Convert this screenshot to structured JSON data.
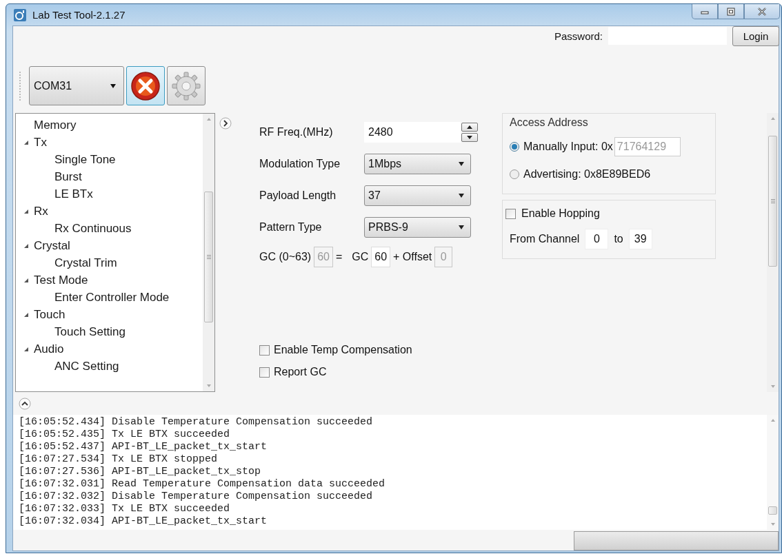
{
  "window": {
    "title": "Lab Test Tool-2.1.27"
  },
  "header": {
    "password_label": "Password:",
    "login_button": "Login"
  },
  "toolbar": {
    "port": "COM31"
  },
  "tree": {
    "items": [
      {
        "label": "Memory",
        "expanded": false
      },
      {
        "label": "Tx",
        "expanded": true,
        "children": [
          {
            "label": "Single Tone"
          },
          {
            "label": "Burst"
          },
          {
            "label": "LE BTx"
          }
        ]
      },
      {
        "label": "Rx",
        "expanded": true,
        "children": [
          {
            "label": "Rx Continuous"
          }
        ]
      },
      {
        "label": "Crystal",
        "expanded": true,
        "children": [
          {
            "label": "Crystal Trim"
          }
        ]
      },
      {
        "label": "Test Mode",
        "expanded": true,
        "children": [
          {
            "label": "Enter Controller Mode"
          }
        ]
      },
      {
        "label": "Touch",
        "expanded": true,
        "children": [
          {
            "label": "Touch Setting"
          }
        ]
      },
      {
        "label": "Audio",
        "expanded": true,
        "children": [
          {
            "label": "ANC Setting"
          }
        ]
      }
    ]
  },
  "form": {
    "rows": [
      {
        "kind": "spin",
        "label": "RF Freq.(MHz)",
        "value": "2480"
      },
      {
        "kind": "dropdown",
        "label": "Modulation Type",
        "value": "1Mbps"
      },
      {
        "kind": "dropdown",
        "label": "Payload Length",
        "value": "37"
      },
      {
        "kind": "dropdown",
        "label": "Pattern Type",
        "value": "PRBS-9"
      }
    ],
    "gc": {
      "label": "GC (0~63)",
      "total": {
        "value": "60",
        "disabled": true
      },
      "equals": "=",
      "gc_label": "GC",
      "gc": {
        "value": "60",
        "disabled": false
      },
      "offset_label": "+ Offset",
      "offset": {
        "value": "0",
        "disabled": true
      }
    },
    "checkboxes": [
      {
        "label": "Enable Temp Compensation",
        "checked": false
      },
      {
        "label": "Report GC",
        "checked": false
      }
    ]
  },
  "access_address": {
    "title": "Access Address",
    "options": [
      {
        "label": "Manually Input: 0x",
        "value": "71764129",
        "selected": true
      },
      {
        "label": "Advertising: 0x8E89BED6",
        "selected": false
      }
    ]
  },
  "hopping": {
    "label": "Enable Hopping",
    "checked": false,
    "from_label": "From Channel",
    "from": "0",
    "to_label": "to",
    "to": "39"
  },
  "log": {
    "lines": [
      "[16:05:52.434] Disable Temperature Compensation succeeded",
      "[16:05:52.435] Tx LE BTX succeeded",
      "[16:05:52.437] API-BT_LE_packet_tx_start",
      "[16:07:27.534] Tx LE BTX stopped",
      "[16:07:27.536] API-BT_LE_packet_tx_stop",
      "[16:07:32.031] Read Temperature Compensation data succeeded",
      "[16:07:32.032] Disable Temperature Compensation succeeded",
      "[16:07:32.033] Tx LE BTX succeeded",
      "[16:07:32.034] API-BT_LE_packet_tx_start"
    ]
  },
  "status_bar": {
    "progress": {
      "level": 0
    }
  }
}
